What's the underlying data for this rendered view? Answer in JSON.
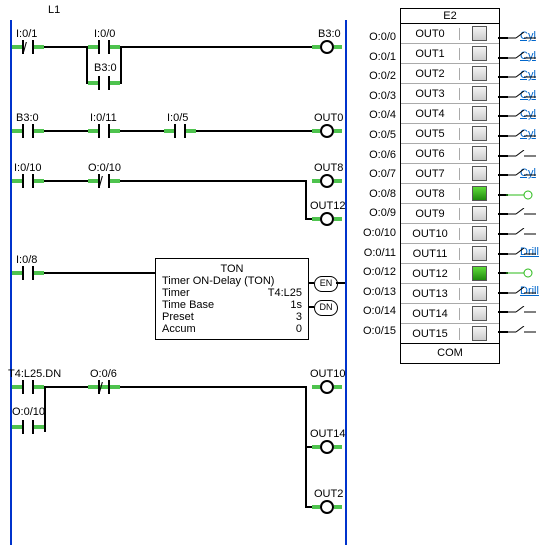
{
  "ladder_title": "L1",
  "module_title": "E2",
  "rungs": {
    "r1": {
      "c1": "I:0/1",
      "c2": "I:0/0",
      "branch": "B3:0",
      "out": "B3:0"
    },
    "r2": {
      "c1": "B3:0",
      "c2": "I:0/11",
      "c3": "I:0/5",
      "out": "OUT0"
    },
    "r3": {
      "c1": "I:0/10",
      "c2": "O:0/10",
      "out1": "OUT8",
      "out2": "OUT12"
    },
    "r4": {
      "c1": "I:0/8",
      "en": "EN",
      "dn": "DN"
    },
    "ton": {
      "hd": "TON",
      "t": "Timer ON-Delay (TON)",
      "l1": "Timer",
      "v1": "T4:L25",
      "l2": "Time Base",
      "v2": "1s",
      "l3": "Preset",
      "v3": "3",
      "l4": "Accum",
      "v4": "0"
    },
    "r5": {
      "c1": "T4:L25.DN",
      "c2": "O:0/6",
      "b": "O:0/10",
      "out1": "OUT10",
      "out2": "OUT14",
      "out3": "OUT2"
    }
  },
  "outputs": [
    {
      "a": "O:0/0",
      "n": "OUT0",
      "on": false,
      "lnk": "Cyl"
    },
    {
      "a": "O:0/1",
      "n": "OUT1",
      "on": false,
      "lnk": "Cyl"
    },
    {
      "a": "O:0/2",
      "n": "OUT2",
      "on": false,
      "lnk": "Cyl"
    },
    {
      "a": "O:0/3",
      "n": "OUT3",
      "on": false,
      "lnk": "Cyl"
    },
    {
      "a": "O:0/4",
      "n": "OUT4",
      "on": false,
      "lnk": "Cyl"
    },
    {
      "a": "O:0/5",
      "n": "OUT5",
      "on": false,
      "lnk": "Cyl"
    },
    {
      "a": "O:0/6",
      "n": "OUT6",
      "on": false,
      "lnk": ""
    },
    {
      "a": "O:0/7",
      "n": "OUT7",
      "on": false,
      "lnk": "Cyl"
    },
    {
      "a": "O:0/8",
      "n": "OUT8",
      "on": true,
      "lnk": ""
    },
    {
      "a": "O:0/9",
      "n": "OUT9",
      "on": false,
      "lnk": ""
    },
    {
      "a": "O:0/10",
      "n": "OUT10",
      "on": false,
      "lnk": ""
    },
    {
      "a": "O:0/11",
      "n": "OUT11",
      "on": false,
      "lnk": "Drill"
    },
    {
      "a": "O:0/12",
      "n": "OUT12",
      "on": true,
      "lnk": ""
    },
    {
      "a": "O:0/13",
      "n": "OUT13",
      "on": false,
      "lnk": "Drill"
    },
    {
      "a": "O:0/14",
      "n": "OUT14",
      "on": false,
      "lnk": ""
    },
    {
      "a": "O:0/15",
      "n": "OUT15",
      "on": false,
      "lnk": ""
    }
  ],
  "com": "COM"
}
